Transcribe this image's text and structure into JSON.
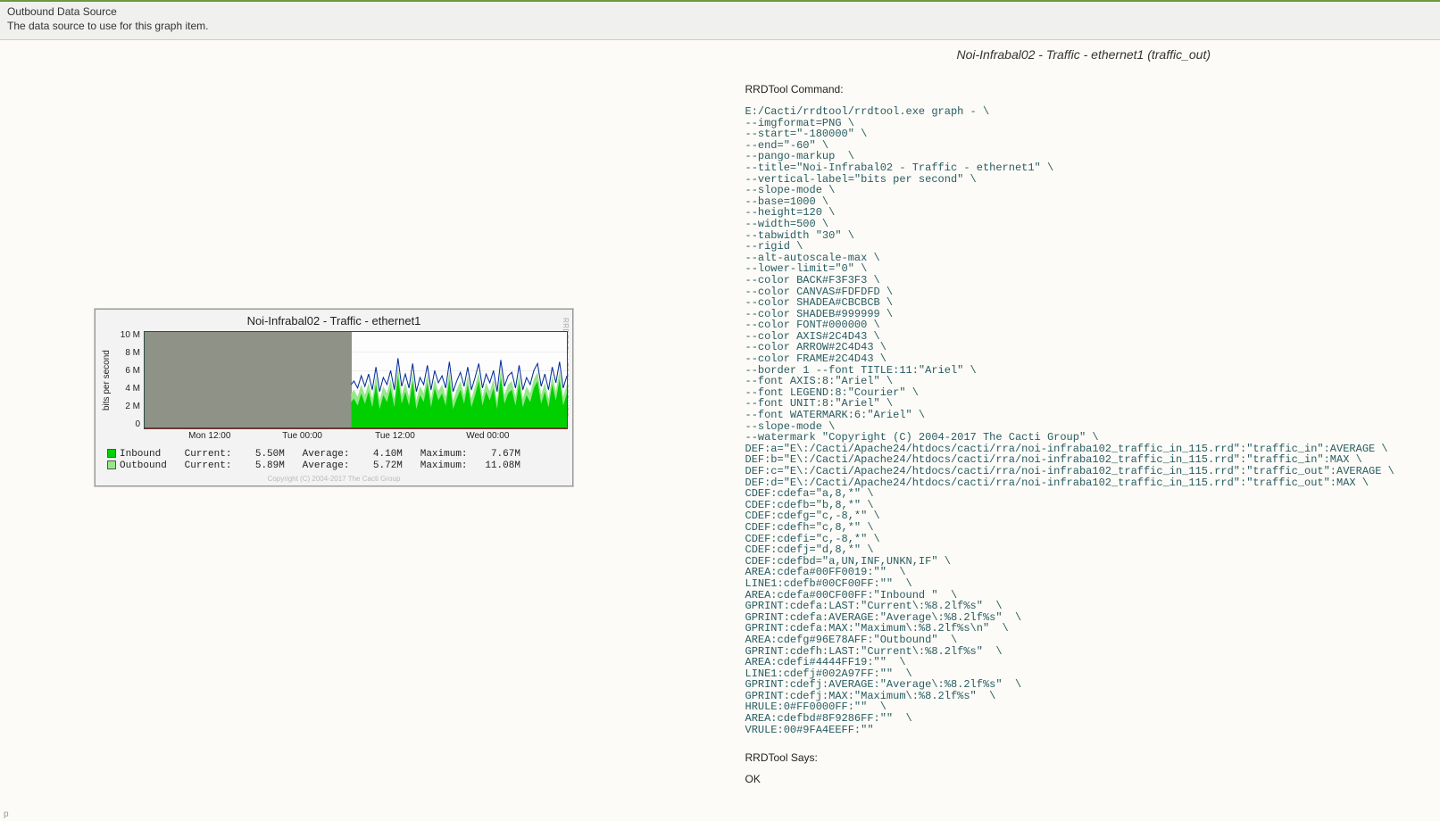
{
  "header": {
    "title": "Outbound Data Source",
    "desc": "The data source to use for this graph item."
  },
  "right": {
    "title": "Noi-Infrabal02 - Traffic - ethernet1 (traffic_out)",
    "rrdtool_command_label": "RRDTool Command:",
    "rrdtool_says_label": "RRDTool Says:",
    "ok": "OK",
    "command": "E:/Cacti/rrdtool/rrdtool.exe graph - \\\n--imgformat=PNG \\\n--start=\"-180000\" \\\n--end=\"-60\" \\\n--pango-markup  \\\n--title=\"Noi-Infrabal02 - Traffic - ethernet1\" \\\n--vertical-label=\"bits per second\" \\\n--slope-mode \\\n--base=1000 \\\n--height=120 \\\n--width=500 \\\n--tabwidth \"30\" \\\n--rigid \\\n--alt-autoscale-max \\\n--lower-limit=\"0\" \\\n--color BACK#F3F3F3 \\\n--color CANVAS#FDFDFD \\\n--color SHADEA#CBCBCB \\\n--color SHADEB#999999 \\\n--color FONT#000000 \\\n--color AXIS#2C4D43 \\\n--color ARROW#2C4D43 \\\n--color FRAME#2C4D43 \\\n--border 1 --font TITLE:11:\"Ariel\" \\\n--font AXIS:8:\"Ariel\" \\\n--font LEGEND:8:\"Courier\" \\\n--font UNIT:8:\"Ariel\" \\\n--font WATERMARK:6:\"Ariel\" \\\n--slope-mode \\\n--watermark \"Copyright (C) 2004-2017 The Cacti Group\" \\\nDEF:a=\"E\\:/Cacti/Apache24/htdocs/cacti/rra/noi-infraba102_traffic_in_115.rrd\":\"traffic_in\":AVERAGE \\\nDEF:b=\"E\\:/Cacti/Apache24/htdocs/cacti/rra/noi-infraba102_traffic_in_115.rrd\":\"traffic_in\":MAX \\\nDEF:c=\"E\\:/Cacti/Apache24/htdocs/cacti/rra/noi-infraba102_traffic_in_115.rrd\":\"traffic_out\":AVERAGE \\\nDEF:d=\"E\\:/Cacti/Apache24/htdocs/cacti/rra/noi-infraba102_traffic_in_115.rrd\":\"traffic_out\":MAX \\\nCDEF:cdefa=\"a,8,*\" \\\nCDEF:cdefb=\"b,8,*\" \\\nCDEF:cdefg=\"c,-8,*\" \\\nCDEF:cdefh=\"c,8,*\" \\\nCDEF:cdefi=\"c,-8,*\" \\\nCDEF:cdefj=\"d,8,*\" \\\nCDEF:cdefbd=\"a,UN,INF,UNKN,IF\" \\\nAREA:cdefa#00FF0019:\"\"  \\\nLINE1:cdefb#00CF00FF:\"\"  \\\nAREA:cdefa#00CF00FF:\"Inbound \"  \\\nGPRINT:cdefa:LAST:\"Current\\:%8.2lf%s\"  \\\nGPRINT:cdefa:AVERAGE:\"Average\\:%8.2lf%s\"  \\\nGPRINT:cdefa:MAX:\"Maximum\\:%8.2lf%s\\n\"  \\\nAREA:cdefg#96E78AFF:\"Outbound\"  \\\nGPRINT:cdefh:LAST:\"Current\\:%8.2lf%s\"  \\\nAREA:cdefi#4444FF19:\"\"  \\\nLINE1:cdefj#002A97FF:\"\"  \\\nGPRINT:cdefj:AVERAGE:\"Average\\:%8.2lf%s\"  \\\nGPRINT:cdefj:MAX:\"Maximum\\:%8.2lf%s\"  \\\nHRULE:0#FF0000FF:\"\"  \\\nAREA:cdefbd#8F9286FF:\"\"  \\\nVRULE:00#9FA4EEFF:\"\""
  },
  "chart_data": {
    "type": "area",
    "title": "Noi-Infrabal02 - Traffic - ethernet1",
    "ylabel": "bits per second",
    "ylim": [
      0,
      11000000
    ],
    "yticks": [
      "10 M",
      "8 M",
      "6 M",
      "4 M",
      "2 M",
      "0"
    ],
    "categories": [
      "Mon 12:00",
      "Tue 00:00",
      "Tue 12:00",
      "Wed 00:00"
    ],
    "nodata_fraction": 0.49,
    "series": [
      {
        "name": "Inbound",
        "color": "#00CF00",
        "current": "5.50M",
        "average": "4.10M",
        "maximum": "7.67M"
      },
      {
        "name": "Outbound",
        "color": "#96E78A",
        "line_color": "#002A97",
        "current": "5.89M",
        "average": "5.72M",
        "maximum": "11.08M"
      }
    ],
    "watermark": "Copyright (C) 2004-2017 The Cacti Group",
    "side_watermark": "RRDTOOL / TOBI OETIKER",
    "legend_labels": {
      "inbound": "Inbound",
      "outbound": "Outbound",
      "current": "Current:",
      "average": "Average:",
      "maximum": "Maximum:"
    }
  },
  "p": "p"
}
